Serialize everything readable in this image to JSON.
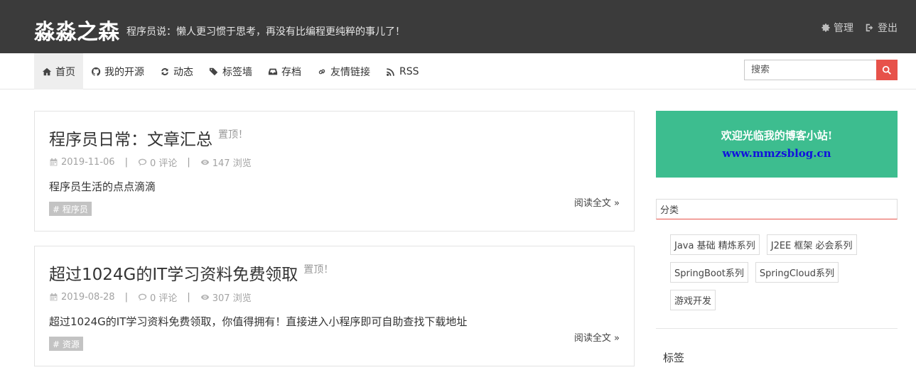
{
  "header": {
    "brand": "淼淼之森",
    "slogan": "程序员说：懒人更习惯于思考，再没有比编程更纯粹的事儿了！",
    "admin_label": "管理",
    "logout_label": "登出"
  },
  "nav": {
    "items": [
      {
        "label": "首页",
        "icon": "home-icon"
      },
      {
        "label": "我的开源",
        "icon": "github-icon"
      },
      {
        "label": "动态",
        "icon": "refresh-icon"
      },
      {
        "label": "标签墙",
        "icon": "tags-icon"
      },
      {
        "label": "存档",
        "icon": "inbox-icon"
      },
      {
        "label": "友情链接",
        "icon": "link-icon"
      },
      {
        "label": "RSS",
        "icon": "rss-icon"
      }
    ],
    "active_index": 0
  },
  "search": {
    "placeholder": "搜索"
  },
  "posts": [
    {
      "title": "程序员日常：文章汇总",
      "pin": "置顶！",
      "date": "2019-11-06",
      "comments": "0 评论",
      "views": "147 浏览",
      "summary": "程序员生活的点点滴滴",
      "tag": "# 程序员",
      "read_more": "阅读全文 »"
    },
    {
      "title": "超过1024G的IT学习资料免费领取",
      "pin": "置顶！",
      "date": "2019-08-28",
      "comments": "0 评论",
      "views": "307 浏览",
      "summary": "超过1024G的IT学习资料免费领取，你值得拥有！直接进入小程序即可自助查找下载地址",
      "tag": "# 资源",
      "read_more": "阅读全文 »"
    }
  ],
  "sidebar": {
    "welcome_line1": "欢迎光临我的博客小站!",
    "welcome_line2": "www.mmzsblog.cn",
    "categories_title": "分类",
    "categories": [
      "Java 基础 精炼系列",
      "J2EE 框架 必会系列",
      "SpringBoot系列",
      "SpringCloud系列",
      "游戏开发"
    ],
    "tags_title": "标签"
  },
  "colors": {
    "header_bg": "#3b3b3b",
    "accent_red": "#e7524a",
    "welcome_green": "#3dbd8f",
    "welcome_link": "#1111dd"
  }
}
